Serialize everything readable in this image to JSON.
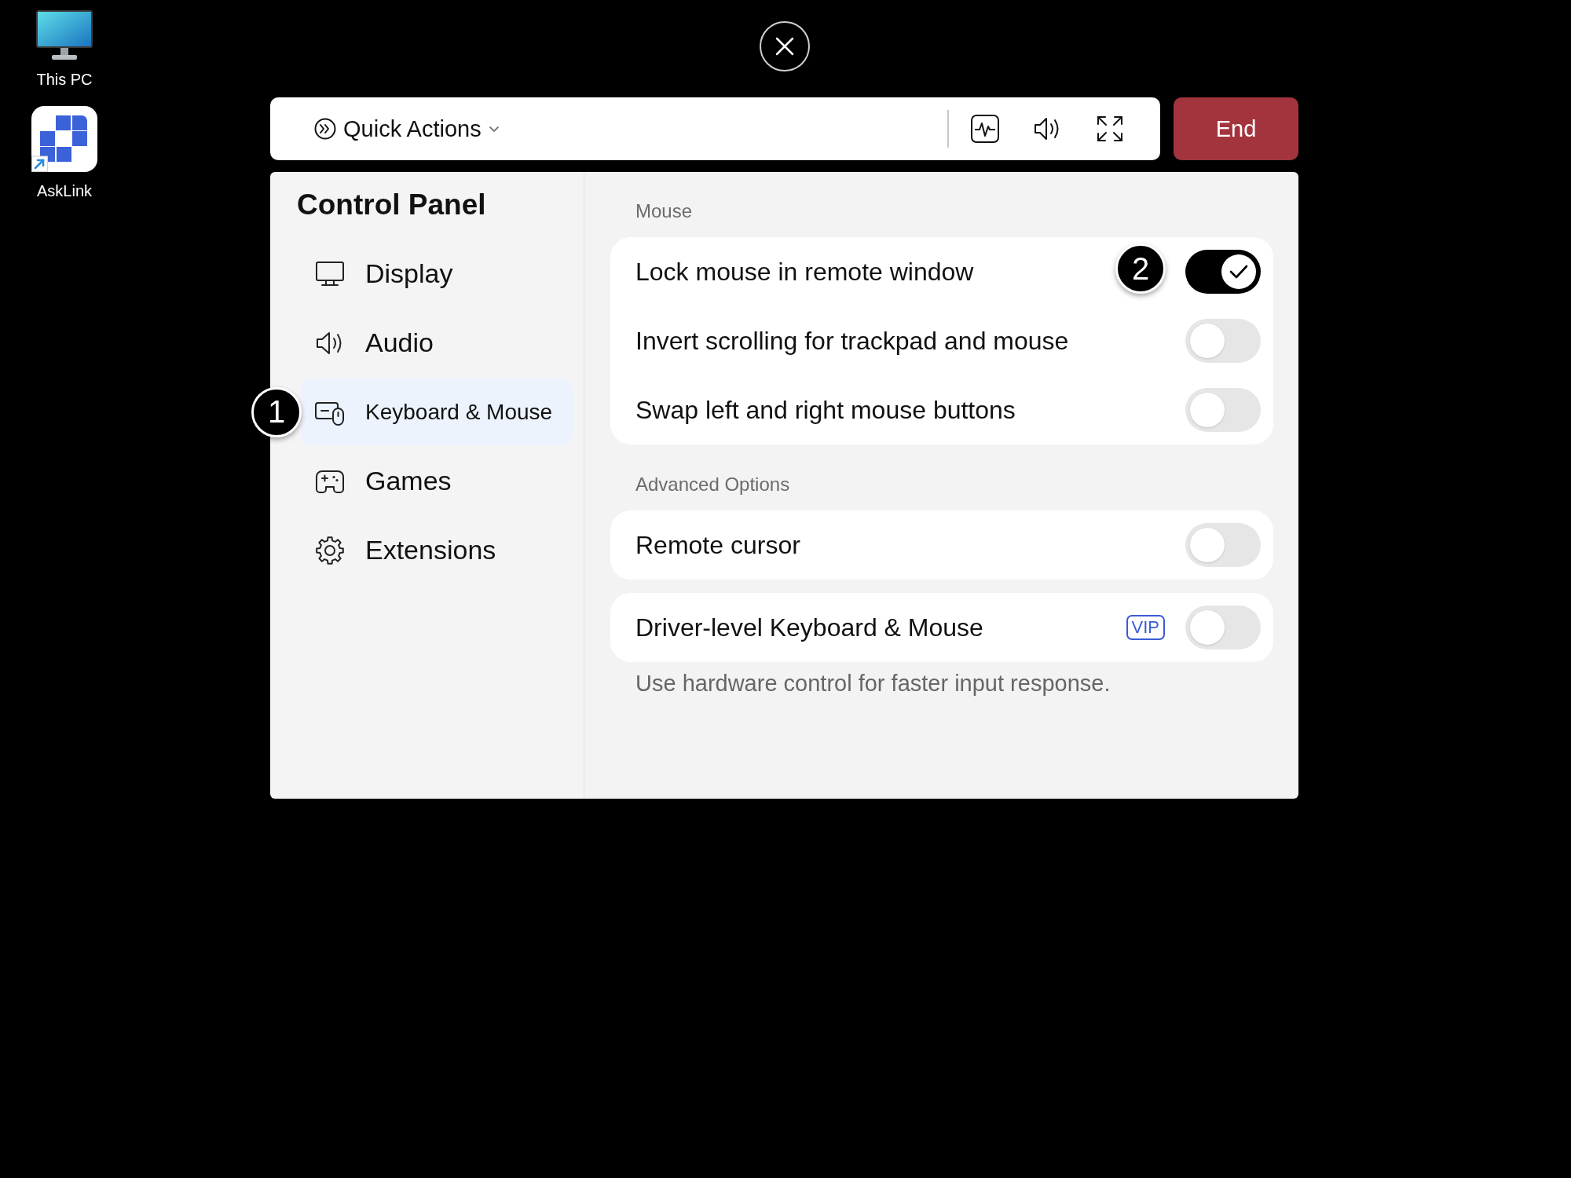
{
  "desktop": {
    "shortcuts": [
      {
        "label": "This PC"
      },
      {
        "label": "AskLink"
      }
    ]
  },
  "toolbar": {
    "quick_actions": "Quick Actions",
    "end_button": "End"
  },
  "control_panel": {
    "title": "Control Panel",
    "nav": [
      {
        "label": "Display",
        "selected": false
      },
      {
        "label": "Audio",
        "selected": false
      },
      {
        "label": "Keyboard & Mouse",
        "selected": true,
        "marker": "1"
      },
      {
        "label": "Games",
        "selected": false
      },
      {
        "label": "Extensions",
        "selected": false
      }
    ]
  },
  "sections": [
    {
      "heading": "Mouse",
      "cards": [
        {
          "rows": [
            {
              "label": "Lock mouse in remote window",
              "on": true,
              "marker": "2"
            },
            {
              "label": "Invert scrolling for trackpad and mouse",
              "on": false
            },
            {
              "label": "Swap left and right mouse buttons",
              "on": false
            }
          ]
        }
      ]
    },
    {
      "heading": "Advanced Options",
      "cards": [
        {
          "rows": [
            {
              "label": "Remote cursor",
              "on": false
            }
          ]
        },
        {
          "rows": [
            {
              "label": "Driver-level Keyboard & Mouse",
              "badge": "VIP",
              "on": false
            }
          ],
          "note": "Use hardware control for faster input response."
        }
      ]
    }
  ]
}
